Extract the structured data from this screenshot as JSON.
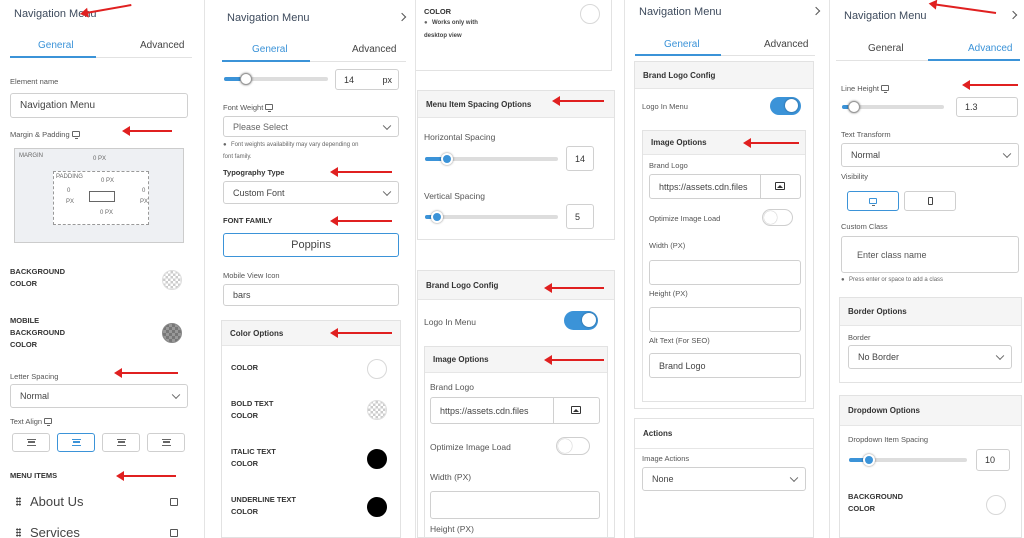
{
  "panel1": {
    "title": "Navigation Menu",
    "tabs": [
      "General",
      "Advanced"
    ],
    "element_name_label": "Element name",
    "element_name_value": "Navigation Menu",
    "margin_padding_label": "Margin & Padding",
    "box_model": {
      "margin": "MARGIN",
      "margin_top": "0 PX",
      "padding": "PADDING",
      "padding_top": "0 PX",
      "left_val": "0",
      "left_unit": "PX",
      "right_val": "0",
      "right_unit": "PX",
      "bottom": "0 PX"
    },
    "background_color_label": [
      "BACKGROUND",
      "COLOR"
    ],
    "mobile_background_label": [
      "MOBILE",
      "BACKGROUND",
      "COLOR"
    ],
    "letter_spacing_label": "Letter Spacing",
    "letter_spacing_value": "Normal",
    "text_align_label": "Text Align",
    "menu_items_label": "MENU ITEMS",
    "menu_items": [
      "About Us",
      "Services"
    ]
  },
  "panel2": {
    "title": "Navigation Menu",
    "tabs": [
      "General",
      "Advanced"
    ],
    "size_value": "14",
    "size_unit": "px",
    "font_weight_label": "Font Weight",
    "font_weight_value": "Please Select",
    "font_weight_hint": [
      "Font weights availability may vary depending on",
      "font family."
    ],
    "typography_label": "Typography Type",
    "typography_value": "Custom Font",
    "font_family_label": "FONT FAMILY",
    "font_family_value": "Poppins",
    "mobile_icon_label": "Mobile View Icon",
    "mobile_icon_value": "bars",
    "color_options_label": "Color Options",
    "color_label": "COLOR",
    "bold_color_label": [
      "BOLD TEXT",
      "COLOR"
    ],
    "italic_color_label": [
      "ITALIC TEXT",
      "COLOR"
    ],
    "underline_color_label": [
      "UNDERLINE TEXT",
      "COLOR"
    ]
  },
  "panel3": {
    "color_label": "COLOR",
    "works_only": [
      "Works only with",
      "desktop view"
    ],
    "spacing_options_label": "Menu Item Spacing Options",
    "horizontal_label": "Horizontal Spacing",
    "horizontal_value": "14",
    "vertical_label": "Vertical Spacing",
    "vertical_value": "5",
    "brand_logo_config_label": "Brand Logo Config",
    "logo_in_menu_label": "Logo In Menu",
    "image_options_label": "Image Options",
    "brand_logo_label": "Brand Logo",
    "brand_logo_value": "https://assets.cdn.files",
    "optimize_label": "Optimize Image Load",
    "width_label": "Width (PX)",
    "height_label": "Height (PX)"
  },
  "panel4": {
    "title": "Navigation Menu",
    "tabs": [
      "General",
      "Advanced"
    ],
    "brand_logo_config_label": "Brand Logo Config",
    "logo_in_menu_label": "Logo In Menu",
    "image_options_label": "Image Options",
    "brand_logo_label": "Brand Logo",
    "brand_logo_value": "https://assets.cdn.files",
    "optimize_label": "Optimize Image Load",
    "width_label": "Width (PX)",
    "height_label": "Height (PX)",
    "alt_label": "Alt Text (For SEO)",
    "alt_value": "Brand Logo",
    "actions_label": "Actions",
    "image_actions_label": "Image Actions",
    "image_actions_value": "None"
  },
  "panel5": {
    "title": "Navigation Menu",
    "tabs": [
      "General",
      "Advanced"
    ],
    "line_height_label": "Line Height",
    "line_height_value": "1.3",
    "text_transform_label": "Text Transform",
    "text_transform_value": "Normal",
    "visibility_label": "Visibility",
    "custom_class_label": "Custom Class",
    "custom_class_placeholder": "Enter class name",
    "custom_class_hint": "Press enter or space to add a class",
    "border_options_label": "Border Options",
    "border_label": "Border",
    "border_value": "No Border",
    "dropdown_options_label": "Dropdown Options",
    "dropdown_spacing_label": "Dropdown Item Spacing",
    "dropdown_spacing_value": "10",
    "bg_color_label": [
      "BACKGROUND",
      "COLOR"
    ]
  },
  "colors": {
    "accent": "#3b93d8",
    "arrow": "#e02020",
    "tab_active": "#3b93d8"
  }
}
